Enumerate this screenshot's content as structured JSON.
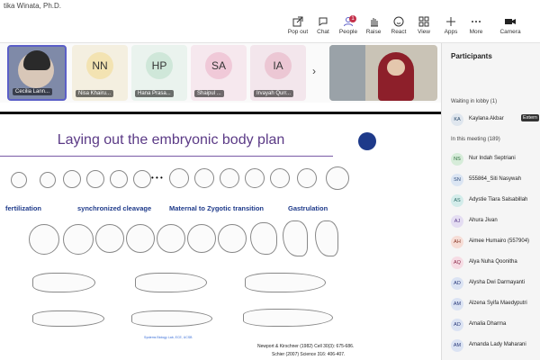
{
  "window": {
    "title": "tika Winata, Ph.D."
  },
  "toolbar": {
    "popout": "Pop out",
    "chat": "Chat",
    "people": "People",
    "people_badge": "1",
    "raise": "Raise",
    "react": "React",
    "view": "View",
    "apps": "Apps",
    "more": "More",
    "camera": "Camera"
  },
  "participants_strip": [
    {
      "name": "Cecilia Lann..."
    },
    {
      "initials": "NN",
      "name": "Nisa Khairu..."
    },
    {
      "initials": "HP",
      "name": "Hana Prasa..."
    },
    {
      "initials": "SA",
      "name": "Shaipul ..."
    },
    {
      "initials": "IA",
      "name": "Irvayah Qurr..."
    }
  ],
  "slide": {
    "title": "Laying out the embryonic body plan",
    "labels": [
      "fertilization",
      "synchronized cleavage",
      "Maternal to Zygotic transition",
      "Gastrulation"
    ],
    "ellipsis": "• • •",
    "refs": [
      "Newport & Kirschner (1982) Cell 30(3): 675-686.",
      "Schier (2007) Science 316: 406-407."
    ],
    "credit": "Systems Biology Lab, ECE, UCSB"
  },
  "panel": {
    "title": "Participants",
    "lobby_header": "Waiting in lobby (1)",
    "lobby": [
      {
        "initials": "KA",
        "name": "Kaylana Akbar",
        "tag": "Extern"
      }
    ],
    "meeting_header": "In this meeting (189)",
    "members": [
      {
        "initials": "NS",
        "name": "Nur Indah Septriani"
      },
      {
        "initials": "SN",
        "name": "555864_Siti Nasywah"
      },
      {
        "initials": "AS",
        "name": "Adystie Tiara Salsabillah"
      },
      {
        "initials": "AJ",
        "name": "Ahura Jivan"
      },
      {
        "initials": "AH",
        "name": "Aimee Humairo (557904)"
      },
      {
        "initials": "AQ",
        "name": "Alya Nuha Qoonitha"
      },
      {
        "initials": "AD",
        "name": "Alysha Dwi Darmayanti"
      },
      {
        "initials": "AM",
        "name": "Alzena Syifa Maedyputri"
      },
      {
        "initials": "AD",
        "name": "Amalia Dharma"
      },
      {
        "initials": "AM",
        "name": "Amanda Lady Maharani"
      }
    ]
  },
  "colors": {
    "accent": "#5b5fc7",
    "slide_title": "#5b3a86",
    "label": "#1e3a8a"
  }
}
